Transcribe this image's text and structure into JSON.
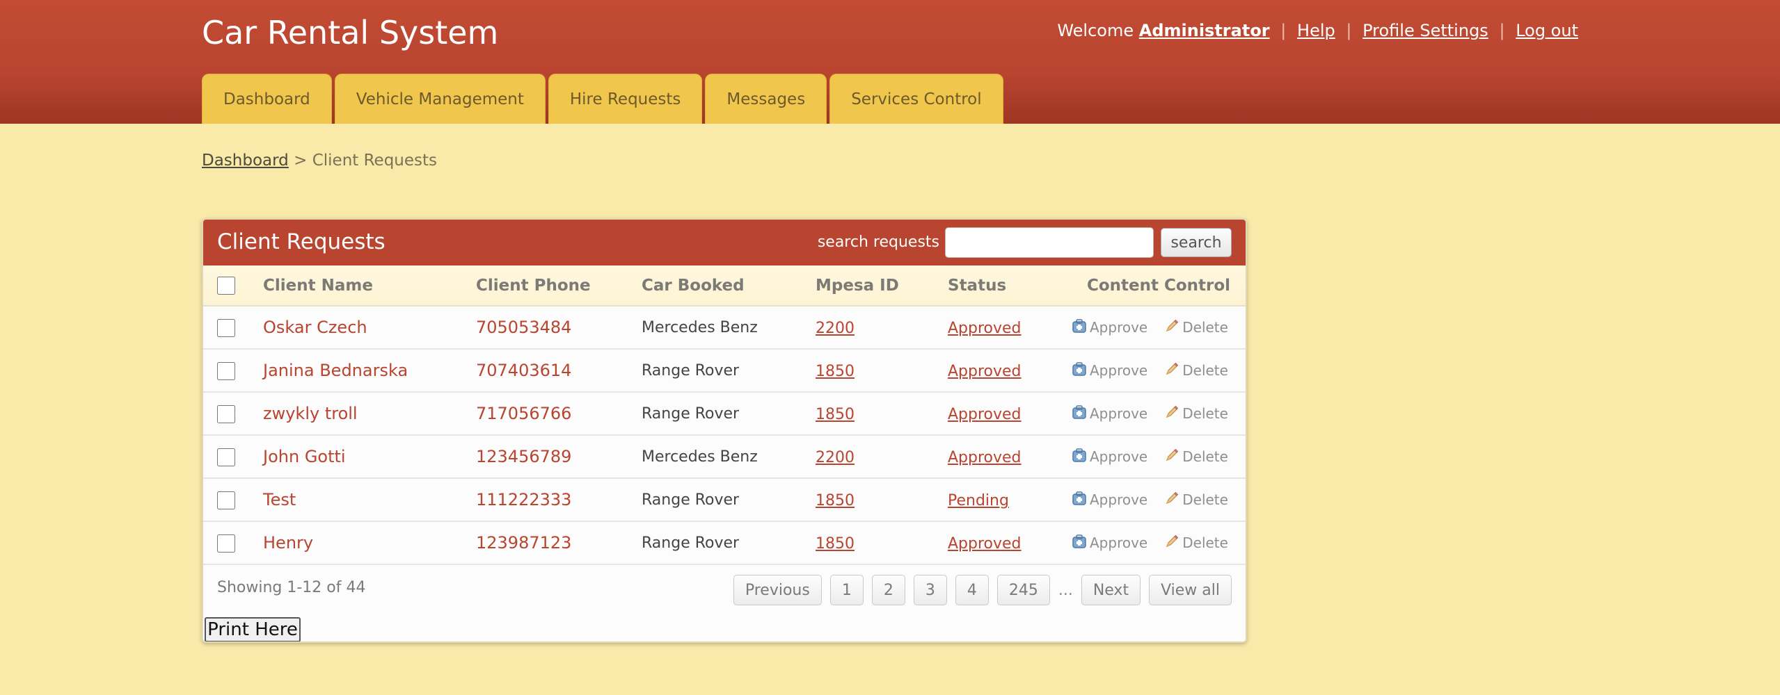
{
  "app_title": "Car Rental System",
  "user_bar": {
    "welcome": "Welcome",
    "user": "Administrator",
    "help": "Help",
    "profile": "Profile Settings",
    "logout": "Log out"
  },
  "nav": [
    "Dashboard",
    "Vehicle Management",
    "Hire Requests",
    "Messages",
    "Services Control"
  ],
  "breadcrumb": {
    "home": "Dashboard",
    "separator": ">",
    "current": "Client Requests"
  },
  "panel": {
    "title": "Client Requests",
    "search_label": "search requests",
    "search_value": "",
    "search_button": "search"
  },
  "table": {
    "headers": {
      "name": "Client Name",
      "phone": "Client Phone",
      "car": "Car Booked",
      "mpesa": "Mpesa ID",
      "status": "Status",
      "control": "Content Control"
    },
    "action_labels": {
      "approve": "Approve",
      "delete": "Delete"
    },
    "rows": [
      {
        "name": "Oskar Czech",
        "phone": "705053484",
        "car": "Mercedes Benz",
        "mpesa": "2200",
        "status": "Approved"
      },
      {
        "name": "Janina Bednarska",
        "phone": "707403614",
        "car": "Range Rover",
        "mpesa": "1850",
        "status": "Approved"
      },
      {
        "name": "zwykly troll",
        "phone": "717056766",
        "car": "Range Rover",
        "mpesa": "1850",
        "status": "Approved"
      },
      {
        "name": "John Gotti",
        "phone": "123456789",
        "car": "Mercedes Benz",
        "mpesa": "2200",
        "status": "Approved"
      },
      {
        "name": "Test",
        "phone": "111222333",
        "car": "Range Rover",
        "mpesa": "1850",
        "status": "Pending"
      },
      {
        "name": "Henry",
        "phone": "123987123",
        "car": "Range Rover",
        "mpesa": "1850",
        "status": "Approved"
      }
    ]
  },
  "footer": {
    "showing": "Showing 1-12 of 44",
    "previous": "Previous",
    "pages": [
      "1",
      "2",
      "3",
      "4",
      "245"
    ],
    "ellipsis": "...",
    "next": "Next",
    "view_all": "View all"
  },
  "print_button": "Print Here",
  "colors": {
    "header": "#b94430",
    "tab": "#f0c74c",
    "background": "#f9eaa9",
    "link": "#b94430"
  },
  "icons": {
    "approve": "approve-icon",
    "delete": "pencil-icon"
  }
}
